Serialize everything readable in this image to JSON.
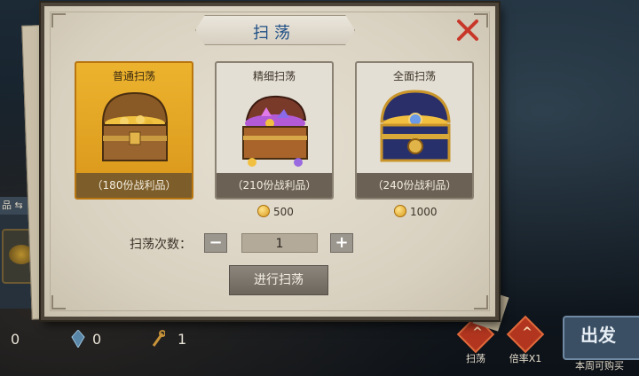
{
  "dialog": {
    "title": "扫荡",
    "options": [
      {
        "name": "普通扫荡",
        "reward": "（180份战利品）",
        "price": "",
        "selected": true,
        "icon": "wooden-chest-icon"
      },
      {
        "name": "精细扫荡",
        "reward": "（210份战利品）",
        "price": "500",
        "selected": false,
        "icon": "gem-chest-icon"
      },
      {
        "name": "全面扫荡",
        "reward": "（240份战利品）",
        "price": "1000",
        "selected": false,
        "icon": "royal-chest-icon"
      }
    ],
    "count_label": "扫荡次数：",
    "count_value": "1",
    "minus_label": "−",
    "plus_label": "+",
    "sweep_button": "进行扫荡"
  },
  "background_ui": {
    "tab_label": "品",
    "stats": [
      "0",
      "0",
      "1"
    ],
    "bottom_buttons": [
      "扫荡",
      "倍率X1"
    ],
    "depart_label": "出发",
    "weekly_text": "本周可购买"
  },
  "colors": {
    "selected_card": "#e0a024",
    "title_text": "#1f4f86",
    "close_x": "#c8382a",
    "coin": "#f2c040"
  }
}
